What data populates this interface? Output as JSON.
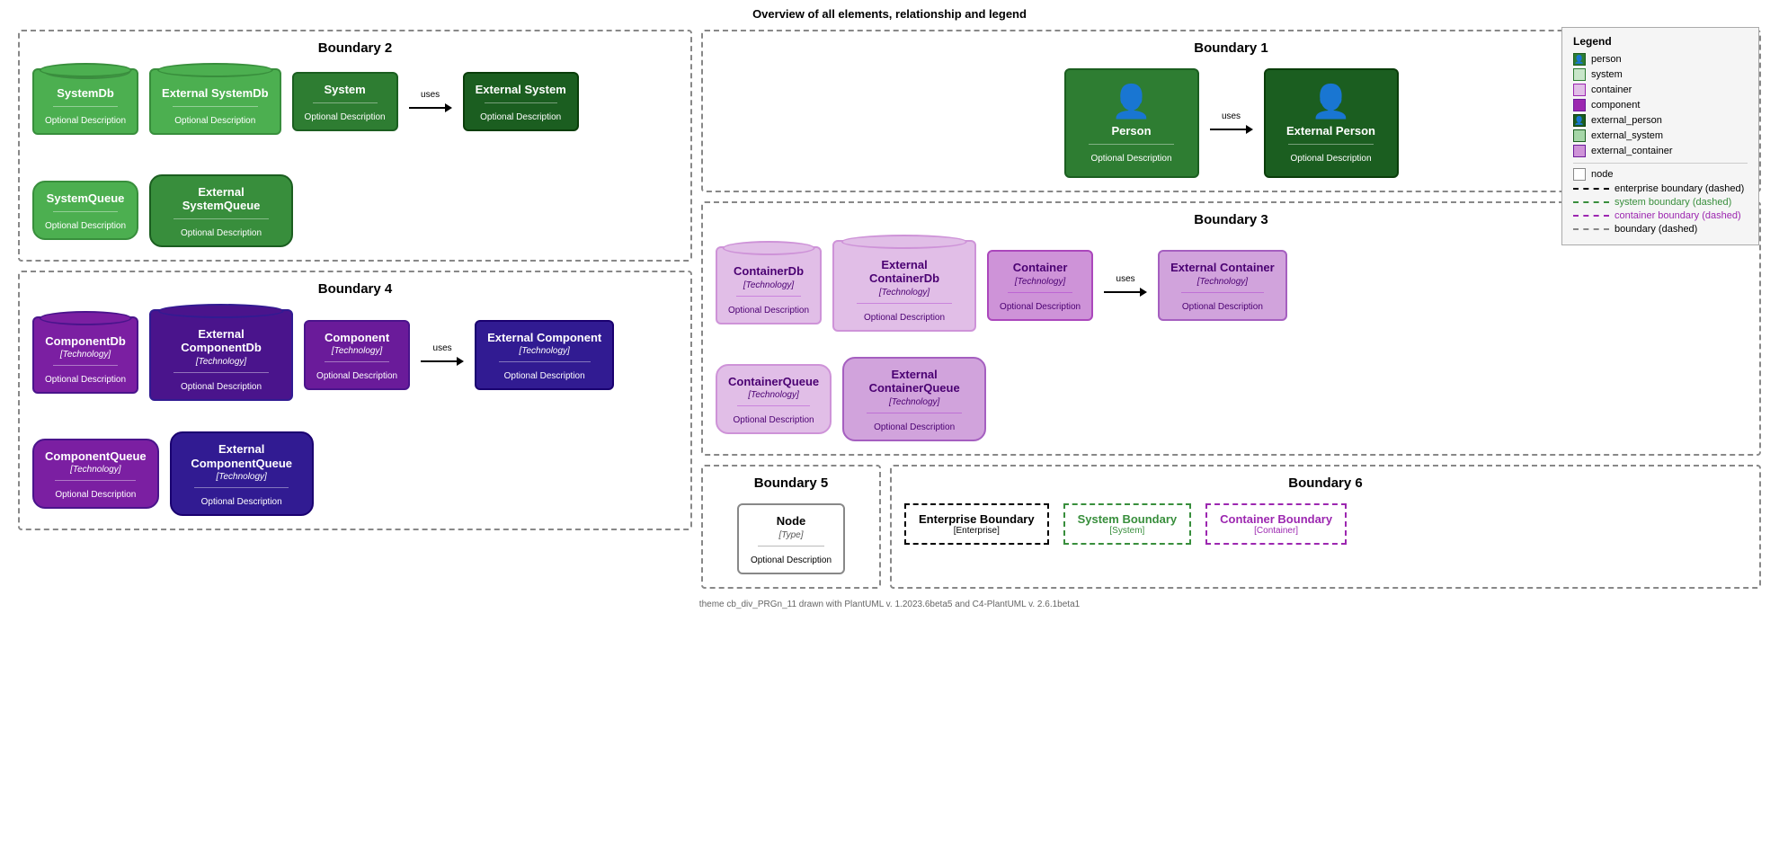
{
  "page": {
    "title": "Overview of all elements, relationship and legend",
    "footer": "theme cb_div_PRGn_11 drawn with PlantUML v. 1.2023.6beta5 and C4-PlantUML v. 2.6.1beta1"
  },
  "boundary2": {
    "title": "Boundary 2",
    "systemDb": {
      "name": "SystemDb",
      "desc": "Optional Description"
    },
    "externalSystemDb": {
      "name": "External SystemDb",
      "desc": "Optional Description"
    },
    "system": {
      "name": "System",
      "desc": "Optional Description"
    },
    "externalSystem": {
      "name": "External System",
      "desc": "Optional Description"
    },
    "uses1": "uses",
    "systemQueue": {
      "name": "SystemQueue",
      "desc": "Optional Description"
    },
    "externalSystemQueue": {
      "name": "External SystemQueue",
      "desc": "Optional Description"
    }
  },
  "boundary1": {
    "title": "Boundary 1",
    "person": {
      "name": "Person",
      "desc": "Optional Description"
    },
    "externalPerson": {
      "name": "External Person",
      "desc": "Optional Description"
    },
    "uses1": "uses"
  },
  "boundary3": {
    "title": "Boundary 3",
    "containerDb": {
      "name": "ContainerDb",
      "tech": "[Technology]",
      "desc": "Optional Description"
    },
    "externalContainerDb": {
      "name": "External ContainerDb",
      "tech": "[Technology]",
      "desc": "Optional Description"
    },
    "container": {
      "name": "Container",
      "tech": "[Technology]",
      "desc": "Optional Description"
    },
    "externalContainer": {
      "name": "External Container",
      "tech": "[Technology]",
      "desc": "Optional Description"
    },
    "uses1": "uses",
    "containerQueue": {
      "name": "ContainerQueue",
      "tech": "[Technology]",
      "desc": "Optional Description"
    },
    "externalContainerQueue": {
      "name": "External ContainerQueue",
      "tech": "[Technology]",
      "desc": "Optional Description"
    }
  },
  "boundary4": {
    "title": "Boundary 4",
    "componentDb": {
      "name": "ComponentDb",
      "tech": "[Technology]",
      "desc": "Optional Description"
    },
    "externalComponentDb": {
      "name": "External ComponentDb",
      "tech": "[Technology]",
      "desc": "Optional Description"
    },
    "component": {
      "name": "Component",
      "tech": "[Technology]",
      "desc": "Optional Description"
    },
    "externalComponent": {
      "name": "External Component",
      "tech": "[Technology]",
      "desc": "Optional Description"
    },
    "uses1": "uses",
    "componentQueue": {
      "name": "ComponentQueue",
      "tech": "[Technology]",
      "desc": "Optional Description"
    },
    "externalComponentQueue": {
      "name": "External ComponentQueue",
      "tech": "[Technology]",
      "desc": "Optional Description"
    }
  },
  "boundary5": {
    "title": "Boundary 5",
    "node": {
      "name": "Node",
      "type": "[Type]",
      "desc": "Optional Description"
    }
  },
  "boundary6": {
    "title": "Boundary 6",
    "enterprise": {
      "name": "Enterprise Boundary",
      "sub": "[Enterprise]"
    },
    "system": {
      "name": "System Boundary",
      "sub": "[System]"
    },
    "container": {
      "name": "Container Boundary",
      "sub": "[Container]"
    }
  },
  "legend": {
    "title": "Legend",
    "items": [
      {
        "label": "person",
        "color": "#2e7d32",
        "type": "block"
      },
      {
        "label": "system",
        "color": "#e8f5e9",
        "border": "#2e7d32",
        "type": "outline"
      },
      {
        "label": "container",
        "color": "#f3e5f5",
        "border": "#9c27b0",
        "type": "outline"
      },
      {
        "label": "component",
        "color": "#9c27b0",
        "type": "block"
      },
      {
        "label": "external_person",
        "color": "#1b5e20",
        "type": "block"
      },
      {
        "label": "external_system",
        "color": "#c8e6c9",
        "border": "#2e7d32",
        "type": "outline"
      },
      {
        "label": "external_container",
        "color": "#e1bee7",
        "border": "#9c27b0",
        "type": "outline"
      },
      {
        "label": "node",
        "color": "#fff",
        "border": "#888",
        "type": "outline"
      },
      {
        "label": "enterprise boundary (dashed)",
        "color": "#000",
        "type": "dashed"
      },
      {
        "label": "system boundary (dashed)",
        "color": "#388e3c",
        "type": "dashed"
      },
      {
        "label": "container boundary (dashed)",
        "color": "#9c27b0",
        "type": "dashed"
      },
      {
        "label": "boundary (dashed)",
        "color": "#888",
        "type": "dashed"
      }
    ]
  }
}
